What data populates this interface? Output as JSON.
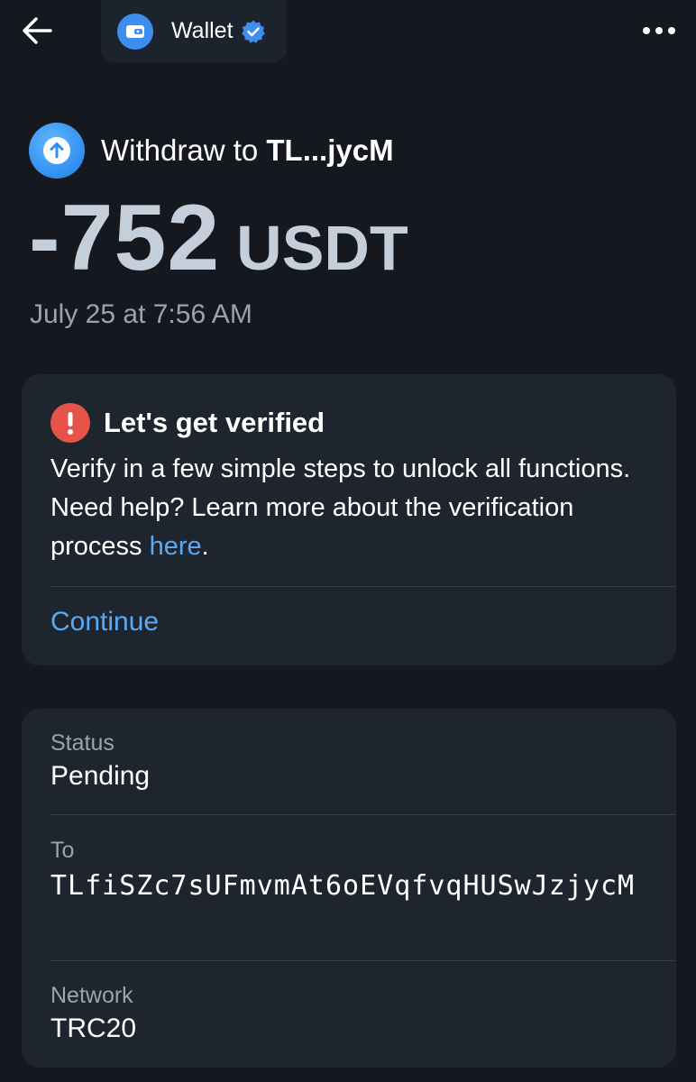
{
  "header": {
    "app_name": "Wallet",
    "back_icon": "arrow-left-icon",
    "more_icon": "more-horizontal-icon",
    "verified_icon": "verified-badge-icon"
  },
  "transaction": {
    "title_prefix": "Withdraw to ",
    "title_address": "TL...jycM",
    "amount": "-752",
    "currency": "USDT",
    "date": "July 25 at 7:56 AM"
  },
  "verify_card": {
    "title": "Let's get verified",
    "body": "Verify in a few simple steps to unlock all functions. Need help? Learn more about the verification process ",
    "link_text": "here",
    "trailing": ".",
    "continue_label": "Continue"
  },
  "details": {
    "status_label": "Status",
    "status_value": "Pending",
    "to_label": "To",
    "to_value": "TLfiSZc7sUFmvmAt6oEVqfvqHUSwJzjycM",
    "network_label": "Network",
    "network_value": "TRC20"
  },
  "colors": {
    "background": "#15181e",
    "card": "#1e252e",
    "accent": "#5aa9f5",
    "alert": "#e5534b"
  }
}
